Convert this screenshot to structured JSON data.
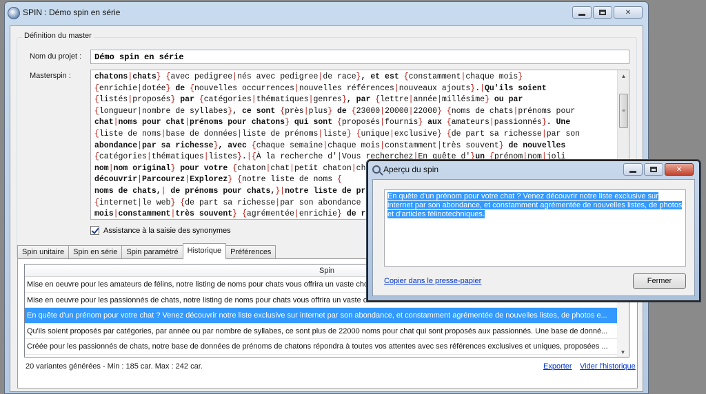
{
  "main_window": {
    "title": "SPIN : Démo spin en série",
    "group_title": "Définition du master",
    "project_label": "Nom du projet :",
    "project_value": "Démo spin en série",
    "masterspin_label": "Masterspin :",
    "masterspin_lines": [
      "chatons|chats} {avec pedigree|nés avec pedigree|de race}, et est {constamment|chaque mois}",
      "{enrichie|dotée} de {nouvelles occurrences|nouvelles références|nouveaux ajouts}.|Qu'ils soient",
      "{listés|proposés} par {catégories|thématiques|genres}, par {lettre|année|millésime} ou par",
      "{longueur|nombre de syllabes}, ce sont {près|plus} de {23000|20000|22000} {noms de chats|prénoms pour",
      "chat|noms pour chat|prénoms pour chatons} qui sont {proposés|fournis} aux {amateurs|passionnés}. Une",
      "{liste de noms|base de données|liste de prénoms|liste} {unique|exclusive} {de part sa richesse|par son",
      "abondance|par sa richesse}, avec {chaque semaine|chaque mois|constamment|très souvent} de nouvelles",
      "{catégories|thématiques|listes}.|{À la recherche d'|Vous recherchez|En quête d'}un {prénom|nom|joli",
      "nom|nom original} pour votre {chaton|chat|petit chaton|ch",
      "découvrir|Parcourez|Explorez} {notre liste de noms {",
      "noms de chats,| de prénoms pour chats,}|notre liste de pr",
      "{internet|le web} {de part sa richesse|par son abondance",
      "mois|constamment|très souvent} {agrémentée|enrichie} de r"
    ],
    "checkbox_label": "Assistance à la saisie des synonymes",
    "tabs": [
      {
        "label": "Spin unitaire"
      },
      {
        "label": "Spin en série"
      },
      {
        "label": "Spin paramétré"
      },
      {
        "label": "Historique"
      },
      {
        "label": "Préférences"
      }
    ],
    "history": {
      "column_header": "Spin",
      "rows": [
        "Mise en oeuvre pour les amateurs de félins, notre listing de noms pour chats vous offrira un vaste choix",
        "Mise en oeuvre pour les passionnés de chats, notre listing de noms pour chats vous offrira un vaste choix",
        "En quête d'un prénom pour votre chat ? Venez découvrir notre liste exclusive sur internet par son abondance, et constamment agrémentée de nouvelles listes, de photos e...",
        "Qu'ils soient proposés par catégories, par année ou par nombre de syllabes, ce sont plus de 22000 noms pour chat qui sont proposés aux passionnés. Une base de donné...",
        "Créée pour les passionnés de chats, notre base de données de prénoms de chatons répondra à toutes vos attentes avec ses références exclusives et uniques, proposées ..."
      ],
      "selected_index": 2
    },
    "status_text": "20 variantes générées - Min : 185 car.    Max : 242 car.",
    "export_link": "Exporter",
    "clear_link": "Vider l'historique"
  },
  "preview_dialog": {
    "title": "Aperçu du spin",
    "text": "En quête d'un prénom pour votre chat ? Venez découvrir notre liste exclusive sur internet par son abondance, et constamment agrémentée de nouvelles listes, de photos et d'articles félinotechniques.",
    "copy_link": "Copier dans le presse-papier",
    "close_button": "Fermer"
  },
  "colors": {
    "selection": "#3399ff",
    "link": "#0033cc",
    "spin_brace": "#b8201a"
  }
}
